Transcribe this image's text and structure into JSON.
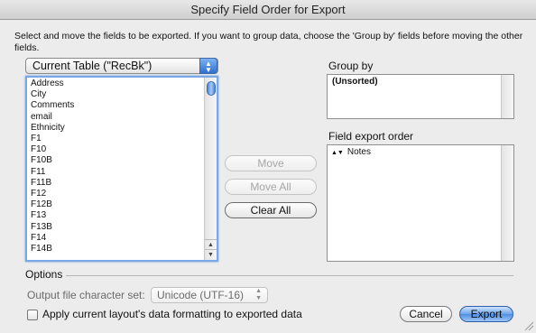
{
  "window": {
    "title": "Specify Field Order for Export"
  },
  "instructions": "Select and move the fields to be exported.  If you want to group data, choose the 'Group by' fields before moving the other fields.",
  "table_selector": {
    "value": "Current Table (\"RecBk\")"
  },
  "fields": [
    "Address",
    "City",
    "Comments",
    "email",
    "Ethnicity",
    "F1",
    "F10",
    "F10B",
    "F11",
    "F11B",
    "F12",
    "F12B",
    "F13",
    "F13B",
    "F14",
    "F14B"
  ],
  "buttons": {
    "move": "Move",
    "move_all": "Move All",
    "clear_all": "Clear All",
    "cancel": "Cancel",
    "export": "Export"
  },
  "group_by": {
    "label": "Group by",
    "items": [
      "(Unsorted)"
    ]
  },
  "field_export_order": {
    "label": "Field export order",
    "items": [
      "Notes"
    ]
  },
  "options": {
    "label": "Options",
    "charset_label": "Output file character set:",
    "charset_value": "Unicode (UTF-16)",
    "apply_formatting_label": "Apply current layout's data formatting to exported data",
    "apply_formatting_checked": false
  },
  "colors": {
    "accent": "#4f8ee4",
    "focus_ring": "#7aa7e6"
  },
  "icons": [
    "popup-stepper-icon",
    "scroll-up-arrow-icon",
    "scroll-down-arrow-icon",
    "reorder-handle-icon",
    "charset-stepper-icon",
    "resize-grip-icon"
  ]
}
